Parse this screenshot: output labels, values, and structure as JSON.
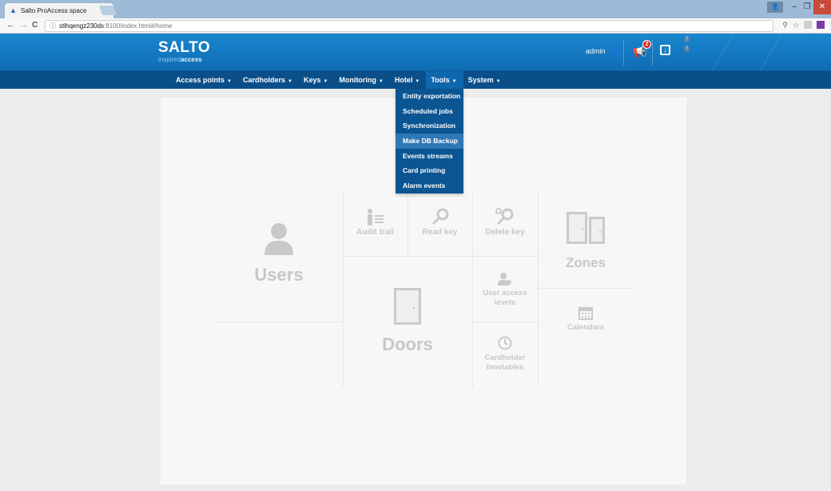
{
  "browser": {
    "tab_title": "Salto ProAccess space",
    "tab_close": "×",
    "url_host": "stlhqengz230ds",
    "url_rest": ":8100/index.html#/home",
    "info_icon": "ⓘ",
    "back_icon": "←",
    "forward_icon": "→",
    "reload_icon": "C",
    "pin_icon": "⚲",
    "star_icon": "☆",
    "win_user_icon": "👤",
    "win_min": "–",
    "win_max": "❐",
    "win_close": "✕"
  },
  "header": {
    "logo_main": "SALTO",
    "logo_sub_light": "inspired",
    "logo_sub_bold": "access",
    "username": "admin",
    "notification_count": "2",
    "dot_1": "?",
    "dot_2": "?"
  },
  "nav": {
    "items": [
      {
        "label": "Access points"
      },
      {
        "label": "Cardholders"
      },
      {
        "label": "Keys"
      },
      {
        "label": "Monitoring"
      },
      {
        "label": "Hotel"
      },
      {
        "label": "Tools"
      },
      {
        "label": "System"
      }
    ],
    "caret": "▼"
  },
  "tools_menu": {
    "items": [
      {
        "label": "Entity exportation"
      },
      {
        "label": "Scheduled jobs"
      },
      {
        "label": "Synchronization"
      },
      {
        "label": "Make DB Backup",
        "highlighted": true
      },
      {
        "label": "Events streams"
      },
      {
        "label": "Card printing"
      },
      {
        "label": "Alarm events"
      }
    ]
  },
  "tiles": {
    "users": "Users",
    "audit_trail": "Audit trail",
    "read_key": "Read key",
    "delete_key": "Delete key",
    "zones": "Zones",
    "doors": "Doors",
    "user_access_levels_1": "User access",
    "user_access_levels_2": "levels",
    "calendars": "Calendars",
    "cardholder_timetables_1": "Cardholder",
    "cardholder_timetables_2": "timetables"
  },
  "colors": {
    "header_blue": "#1a86cf",
    "nav_blue": "#0a4f8a",
    "dropdown_blue": "#0b5593",
    "dropdown_highlight": "#2f77b5",
    "badge_red": "#e2262b",
    "tile_grey": "#c7c7c7"
  }
}
